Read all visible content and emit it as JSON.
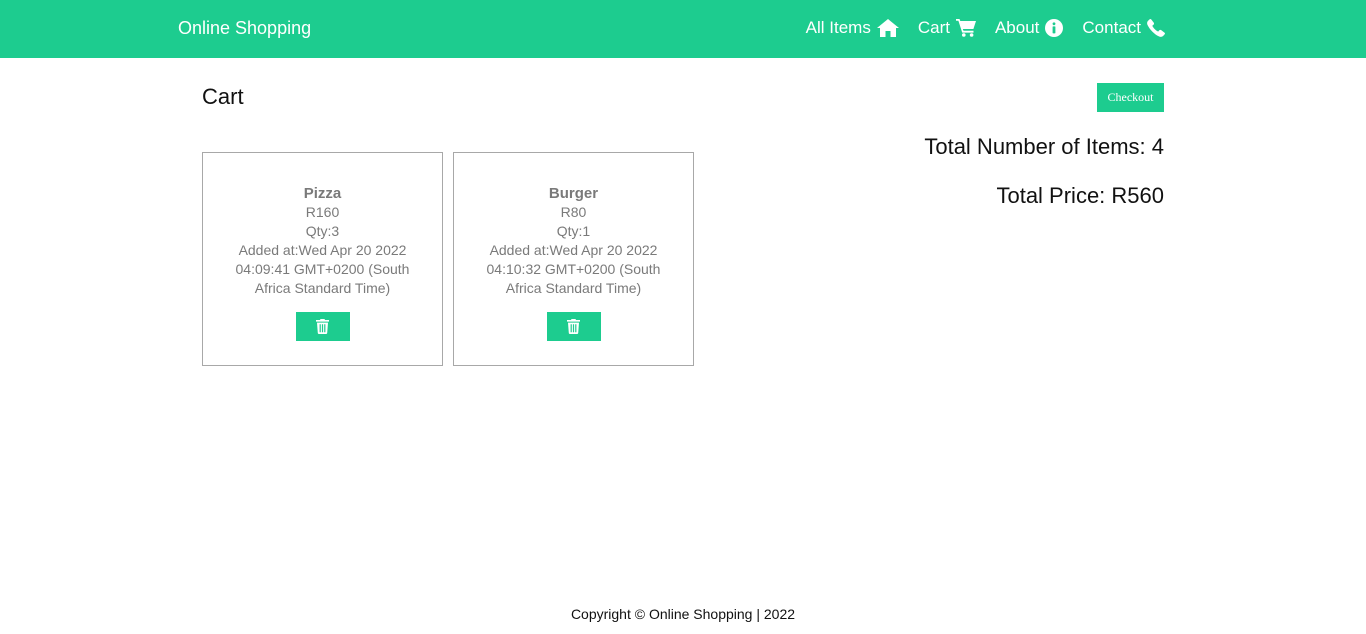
{
  "navbar": {
    "brand": "Online Shopping",
    "items": [
      {
        "label": "All Items",
        "icon": "home-icon"
      },
      {
        "label": "Cart",
        "icon": "cart-icon"
      },
      {
        "label": "About",
        "icon": "info-icon"
      },
      {
        "label": "Contact",
        "icon": "phone-icon"
      }
    ]
  },
  "page": {
    "title": "Cart",
    "checkout_label": "Checkout"
  },
  "summary": {
    "total_items": "Total Number of Items: 4",
    "total_price": "Total Price: R560"
  },
  "cart_items": [
    {
      "name": "Pizza",
      "price": "R160",
      "qty": "Qty:3",
      "added": "Added at:Wed Apr 20 2022 04:09:41 GMT+0200 (South Africa Standard Time)"
    },
    {
      "name": "Burger",
      "price": "R80",
      "qty": "Qty:1",
      "added": "Added at:Wed Apr 20 2022 04:10:32 GMT+0200 (South Africa Standard Time)"
    }
  ],
  "footer": {
    "copyright": "Copyright © Online Shopping | 2022"
  },
  "colors": {
    "accent": "#1dcc8f",
    "card_text": "#7a7a7a",
    "card_border": "#a8a8a8"
  }
}
